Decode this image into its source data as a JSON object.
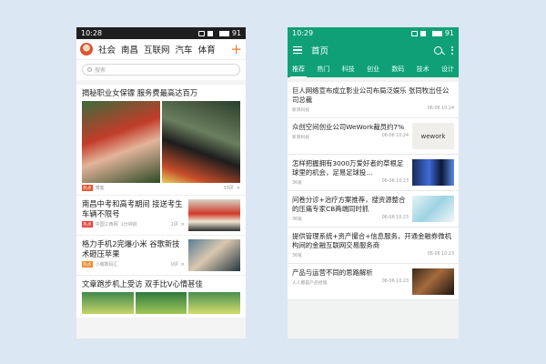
{
  "left": {
    "status": {
      "time": "10:28",
      "battery": "91"
    },
    "nav": {
      "tabs": [
        "社会",
        "南昌",
        "互联网",
        "汽车",
        "体育"
      ],
      "plus": "+"
    },
    "search": {
      "placeholder": "搜索"
    },
    "articles": [
      {
        "title": "揭秘职业女保镖 服务费最高达百万",
        "tag": "热点",
        "source": "博客",
        "stats": "33评",
        "dismiss": "×"
      },
      {
        "title": "南昌中考和高考期间 接送考生车辆不限号",
        "tag": "热点",
        "source": "中国江西网",
        "time": "1分钟前",
        "stats": "1评",
        "dismiss": "×"
      },
      {
        "title": "格力手机2完爆小米 谷歌新技术砸压苹果",
        "tag": "热点",
        "source": "小萌数码汇",
        "stats": "0评",
        "dismiss": "×"
      },
      {
        "title": "文章跑步机上受访 双手比V心情甚佳"
      }
    ]
  },
  "right": {
    "status": {
      "time": "10:29",
      "battery": "91"
    },
    "appbar": {
      "title": "首页"
    },
    "tabs": [
      "推荐",
      "热门",
      "科技",
      "创业",
      "数码",
      "技术",
      "设计"
    ],
    "articles": [
      {
        "title": "巨人网络宣布成立影业公司布局泛娱乐 张同牧出任公司总裁",
        "source": "新浪科技",
        "date": "06-06 10:24"
      },
      {
        "title": "众创空间创业公司WeWork裁员约7%",
        "source": "新浪科技",
        "date": "06-06 10:24",
        "thumb_label": "wework"
      },
      {
        "title": "怎样把握拥有3000万爱好者的草根足球里的机会，足易足球投...",
        "source": "36氪",
        "date": "06-06 10:23"
      },
      {
        "title": "问卷分诊+治疗方案推荐，搜资源整合的压痛专家CB两端同时抓",
        "source": "36氪",
        "date": "06-06 10:23"
      },
      {
        "title": "提供管理系统+资产撮合+信息服务，开通金融券微机构间的金融互联网交易服务商",
        "source": "36氪",
        "date": "06-06 10:23"
      },
      {
        "title": "产品与运营不同的思路解析",
        "source": "人人都是产品经理",
        "date": "06-06 10:23"
      }
    ]
  },
  "colors": {
    "left_accent": "#f5772b",
    "right_brand": "#10a078"
  }
}
